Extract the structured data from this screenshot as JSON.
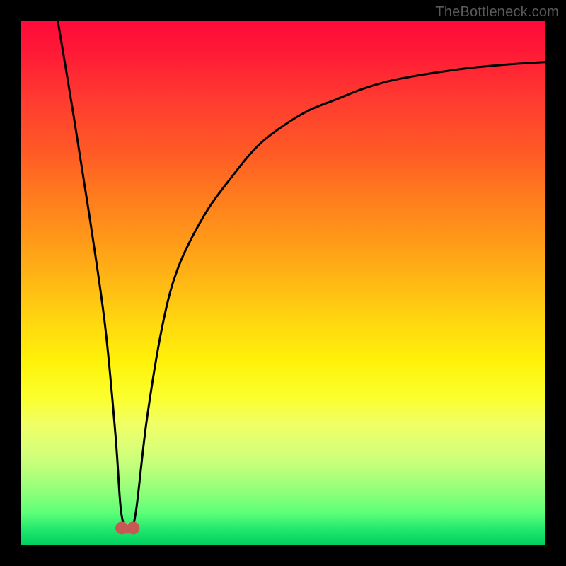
{
  "watermark": "TheBottleneck.com",
  "chart_data": {
    "type": "line",
    "title": "",
    "xlabel": "",
    "ylabel": "",
    "xlim": [
      0,
      100
    ],
    "ylim": [
      0,
      100
    ],
    "series": [
      {
        "name": "curve",
        "x": [
          7,
          10,
          13,
          16,
          18,
          19,
          20,
          21,
          22,
          24,
          27,
          30,
          35,
          40,
          45,
          50,
          55,
          60,
          65,
          70,
          75,
          80,
          85,
          90,
          95,
          100
        ],
        "values": [
          100,
          82,
          63,
          42,
          21,
          7,
          3,
          3,
          7,
          24,
          42,
          53,
          63,
          70,
          76,
          80,
          83,
          85,
          87,
          88.5,
          89.5,
          90.3,
          91,
          91.5,
          91.9,
          92.2
        ]
      }
    ],
    "markers": [
      {
        "x": 19.2,
        "y": 3.2
      },
      {
        "x": 21.4,
        "y": 3.2
      }
    ],
    "marker_connection": [
      [
        19.2,
        3.2
      ],
      [
        21.4,
        3.2
      ]
    ],
    "background_gradient": {
      "direction": "bottom",
      "stops": [
        {
          "pos": 0,
          "color": "#ff0a3a"
        },
        {
          "pos": 50,
          "color": "#ffb914"
        },
        {
          "pos": 72,
          "color": "#fbff2e"
        },
        {
          "pos": 100,
          "color": "#00d060"
        }
      ]
    }
  }
}
